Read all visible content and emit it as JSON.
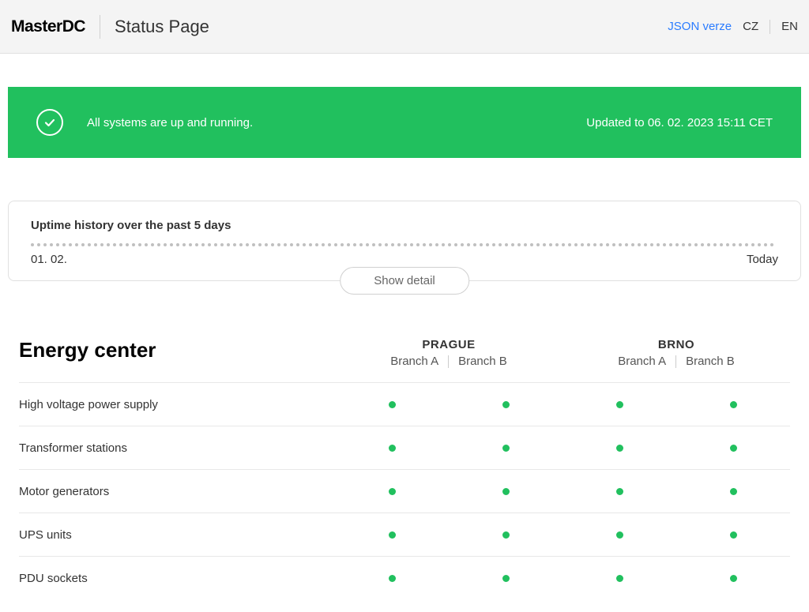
{
  "header": {
    "logo_text": "MasterDC",
    "page_title": "Status Page",
    "json_link": "JSON verze",
    "lang_cz": "CZ",
    "lang_en": "EN"
  },
  "banner": {
    "message": "All systems are up and running.",
    "updated": "Updated to 06. 02. 2023 15:11 CET"
  },
  "uptime": {
    "title": "Uptime history over the past 5 days",
    "start_date": "01. 02.",
    "end_date": "Today",
    "show_detail": "Show detail"
  },
  "section": {
    "title": "Energy center",
    "locations": [
      {
        "name": "PRAGUE",
        "branch_a": "Branch A",
        "branch_b": "Branch B"
      },
      {
        "name": "BRNO",
        "branch_a": "Branch A",
        "branch_b": "Branch B"
      }
    ],
    "rows": [
      {
        "label": "High voltage power supply",
        "status": [
          "ok",
          "ok",
          "ok",
          "ok"
        ]
      },
      {
        "label": "Transformer stations",
        "status": [
          "ok",
          "ok",
          "ok",
          "ok"
        ]
      },
      {
        "label": "Motor generators",
        "status": [
          "ok",
          "ok",
          "ok",
          "ok"
        ]
      },
      {
        "label": "UPS units",
        "status": [
          "ok",
          "ok",
          "ok",
          "ok"
        ]
      },
      {
        "label": "PDU sockets",
        "status": [
          "ok",
          "ok",
          "ok",
          "ok"
        ]
      }
    ]
  }
}
